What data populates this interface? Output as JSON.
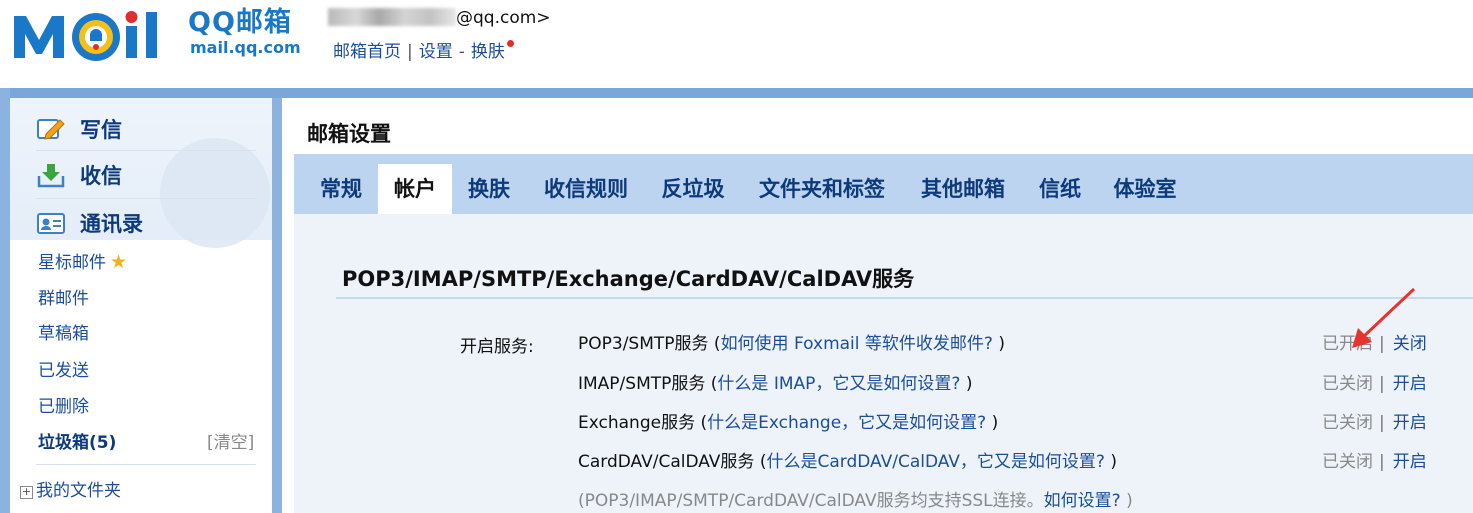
{
  "header": {
    "logo_cn": "QQ邮箱",
    "logo_en": "mail.qq.com",
    "account_suffix": "@qq.com>",
    "links": {
      "home": "邮箱首页",
      "settings": "设置",
      "skin": "换肤"
    }
  },
  "sidebar": {
    "compose": "写信",
    "inbox": "收信",
    "contacts": "通讯录",
    "items": [
      "星标邮件",
      "群邮件",
      "草稿箱",
      "已发送",
      "已删除"
    ],
    "trash_label": "垃圾箱(5)",
    "trash_clear": "[清空]",
    "my_folders": "我的文件夹"
  },
  "main": {
    "title": "邮箱设置",
    "tabs": [
      {
        "label": "常规"
      },
      {
        "label": "帐户"
      },
      {
        "label": "换肤"
      },
      {
        "label": "收信规则"
      },
      {
        "label": "反垃圾"
      },
      {
        "label": "文件夹和标签"
      },
      {
        "label": "其他邮箱"
      },
      {
        "label": "信纸"
      },
      {
        "label": "体验室"
      }
    ],
    "active_tab": "帐户",
    "section_title": "POP3/IMAP/SMTP/Exchange/CardDAV/CalDAV服务",
    "service_label": "开启服务:",
    "services": [
      {
        "name": "POP3/SMTP服务 (",
        "help": "如何使用 Foxmail 等软件收发邮件?",
        "close": " )",
        "status": "已开启",
        "action": "关闭"
      },
      {
        "name": "IMAP/SMTP服务 (",
        "help": "什么是 IMAP，它又是如何设置?",
        "close": " )",
        "status": "已关闭",
        "action": "开启"
      },
      {
        "name": "Exchange服务 (",
        "help": "什么是Exchange，它又是如何设置?",
        "close": " )",
        "status": "已关闭",
        "action": "开启"
      },
      {
        "name": "CardDAV/CalDAV服务 (",
        "help": "什么是CardDAV/CalDAV，它又是如何设置?",
        "close": " )",
        "status": "已关闭",
        "action": "开启"
      }
    ],
    "note_prefix": "(POP3/IMAP/SMTP/CardDAV/CalDAV服务均支持SSL连接。",
    "note_link": "如何设置?",
    "note_suffix": " )"
  },
  "colors": {
    "accent": "#1b4e9a",
    "tab_bar": "#bcd4ef",
    "frame": "#8cb3e0",
    "arrow": "#e8322e"
  }
}
